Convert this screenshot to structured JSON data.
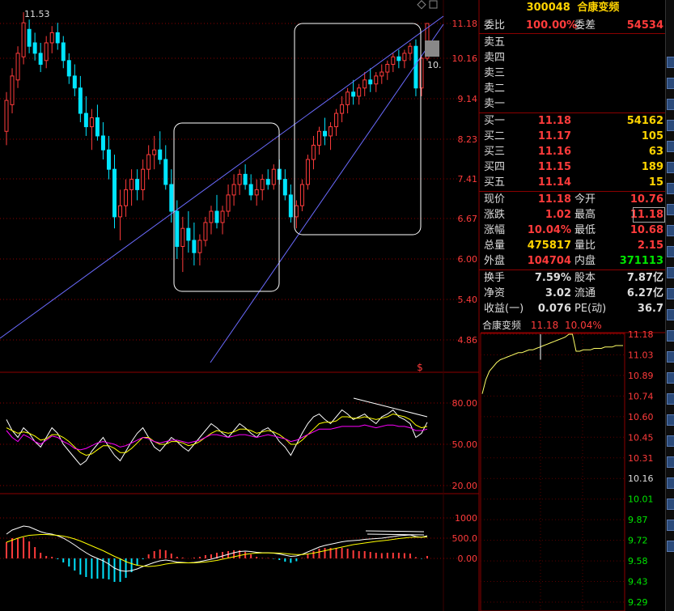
{
  "stock": {
    "code": "300048",
    "name": "合康变频",
    "peak_label": "11.53",
    "right_edge_label": "10."
  },
  "price_axis": [
    "11.18",
    "10.16",
    "9.14",
    "8.23",
    "7.41",
    "6.67",
    "6.00",
    "5.40",
    "4.86"
  ],
  "kdj_axis": [
    "80.00",
    "50.00",
    "20.00"
  ],
  "macd_axis": [
    "1000",
    "500.0",
    "0.00"
  ],
  "quote": {
    "weibi_label": "委比",
    "weibi_value": "100.00%",
    "weicha_label": "委差",
    "weicha_value": "54534",
    "sell": [
      {
        "label": "卖五",
        "price": "",
        "vol": ""
      },
      {
        "label": "卖四",
        "price": "",
        "vol": ""
      },
      {
        "label": "卖三",
        "price": "",
        "vol": ""
      },
      {
        "label": "卖二",
        "price": "",
        "vol": ""
      },
      {
        "label": "卖一",
        "price": "",
        "vol": ""
      }
    ],
    "buy": [
      {
        "label": "买一",
        "price": "11.18",
        "vol": "54162"
      },
      {
        "label": "买二",
        "price": "11.17",
        "vol": "105"
      },
      {
        "label": "买三",
        "price": "11.16",
        "vol": "63"
      },
      {
        "label": "买四",
        "price": "11.15",
        "vol": "189"
      },
      {
        "label": "买五",
        "price": "11.14",
        "vol": "15"
      }
    ],
    "stats": [
      {
        "l1": "现价",
        "v1": "11.18",
        "c1": "red",
        "l2": "今开",
        "v2": "10.76",
        "c2": "red"
      },
      {
        "l1": "涨跌",
        "v1": "1.02",
        "c1": "red",
        "l2": "最高",
        "v2": "11.18",
        "c2": "red"
      },
      {
        "l1": "涨幅",
        "v1": "10.04%",
        "c1": "red",
        "l2": "最低",
        "v2": "10.68",
        "c2": "red"
      },
      {
        "l1": "总量",
        "v1": "475817",
        "c1": "yellow",
        "l2": "量比",
        "v2": "2.15",
        "c2": "red"
      },
      {
        "l1": "外盘",
        "v1": "104704",
        "c1": "red",
        "l2": "内盘",
        "v2": "371113",
        "c2": "green"
      }
    ],
    "fundamentals": [
      {
        "l1": "换手",
        "v1": "7.59%",
        "l2": "股本",
        "v2": "7.87亿"
      },
      {
        "l1": "净资",
        "v1": "3.02",
        "l2": "流通",
        "v2": "6.27亿"
      },
      {
        "l1": "收益(一)",
        "v1": "0.076",
        "l2": "PE(动)",
        "v2": "36.7"
      }
    ]
  },
  "mini_chart": {
    "title_name": "合康变频",
    "title_price": "11.18",
    "title_pct": "10.04%",
    "axis": [
      "11.18",
      "11.03",
      "10.89",
      "10.74",
      "10.60",
      "10.45",
      "10.31",
      "10.16",
      "10.01",
      "9.87",
      "9.72",
      "9.58",
      "9.43",
      "9.29"
    ]
  },
  "colors": {
    "up": "#ff3b3b",
    "down": "#00e5ff",
    "kdj_k": "#ffffff",
    "kdj_d": "#ffff00",
    "kdj_j": "#ff00ff",
    "trend_line": "#6b6bff",
    "grid": "#8b0000"
  },
  "candles": [
    [
      8.4,
      9.3,
      8.1,
      9.1
    ],
    [
      9.0,
      9.9,
      8.8,
      9.7
    ],
    [
      9.6,
      10.5,
      9.4,
      10.3
    ],
    [
      10.2,
      11.53,
      10.0,
      11.2
    ],
    [
      11.0,
      11.3,
      10.3,
      10.5
    ],
    [
      10.6,
      10.9,
      10.1,
      10.3
    ],
    [
      10.3,
      10.6,
      9.8,
      10.0
    ],
    [
      10.1,
      10.8,
      9.9,
      10.6
    ],
    [
      10.6,
      11.1,
      10.3,
      10.9
    ],
    [
      10.9,
      11.2,
      10.4,
      10.6
    ],
    [
      10.6,
      10.8,
      9.9,
      10.1
    ],
    [
      10.1,
      10.3,
      9.5,
      9.7
    ],
    [
      9.7,
      10.0,
      9.2,
      9.4
    ],
    [
      9.4,
      9.7,
      8.6,
      8.8
    ],
    [
      8.8,
      9.2,
      8.3,
      8.5
    ],
    [
      8.5,
      8.9,
      8.0,
      8.7
    ],
    [
      8.7,
      9.0,
      8.2,
      8.3
    ],
    [
      8.3,
      8.6,
      7.8,
      8.0
    ],
    [
      8.0,
      8.3,
      7.4,
      7.6
    ],
    [
      7.6,
      7.9,
      6.5,
      6.7
    ],
    [
      6.7,
      7.2,
      6.3,
      6.9
    ],
    [
      6.9,
      7.4,
      6.7,
      7.2
    ],
    [
      7.2,
      7.6,
      6.9,
      7.4
    ],
    [
      7.4,
      7.6,
      7.0,
      7.2
    ],
    [
      7.2,
      7.8,
      7.0,
      7.6
    ],
    [
      7.6,
      8.1,
      7.4,
      7.9
    ],
    [
      7.9,
      8.3,
      7.6,
      8.0
    ],
    [
      8.0,
      8.4,
      7.7,
      7.8
    ],
    [
      7.8,
      8.1,
      7.2,
      7.3
    ],
    [
      7.3,
      7.6,
      6.6,
      6.8
    ],
    [
      6.8,
      7.0,
      6.0,
      6.2
    ],
    [
      6.2,
      6.7,
      5.8,
      6.5
    ],
    [
      6.5,
      6.8,
      6.1,
      6.3
    ],
    [
      6.3,
      6.6,
      5.9,
      6.1
    ],
    [
      6.1,
      6.4,
      5.9,
      6.3
    ],
    [
      6.3,
      6.7,
      6.2,
      6.6
    ],
    [
      6.6,
      6.9,
      6.4,
      6.8
    ],
    [
      6.8,
      7.1,
      6.5,
      6.6
    ],
    [
      6.6,
      6.9,
      6.4,
      6.8
    ],
    [
      6.8,
      7.3,
      6.7,
      7.1
    ],
    [
      7.1,
      7.5,
      6.9,
      7.3
    ],
    [
      7.3,
      7.6,
      7.1,
      7.5
    ],
    [
      7.5,
      7.7,
      7.2,
      7.3
    ],
    [
      7.3,
      7.5,
      7.0,
      7.1
    ],
    [
      7.1,
      7.4,
      6.9,
      7.2
    ],
    [
      7.2,
      7.5,
      7.0,
      7.4
    ],
    [
      7.4,
      7.6,
      7.2,
      7.3
    ],
    [
      7.3,
      7.7,
      7.2,
      7.6
    ],
    [
      7.6,
      7.8,
      7.3,
      7.4
    ],
    [
      7.4,
      7.6,
      7.0,
      7.1
    ],
    [
      7.1,
      7.3,
      6.6,
      6.7
    ],
    [
      6.7,
      7.0,
      6.5,
      6.9
    ],
    [
      6.9,
      7.4,
      6.8,
      7.3
    ],
    [
      7.3,
      7.9,
      7.2,
      7.8
    ],
    [
      7.8,
      8.3,
      7.6,
      8.1
    ],
    [
      8.1,
      8.5,
      7.9,
      8.4
    ],
    [
      8.4,
      8.7,
      8.1,
      8.3
    ],
    [
      8.3,
      8.6,
      8.0,
      8.5
    ],
    [
      8.5,
      8.9,
      8.3,
      8.8
    ],
    [
      8.8,
      9.2,
      8.6,
      9.0
    ],
    [
      9.0,
      9.4,
      8.8,
      9.3
    ],
    [
      9.3,
      9.6,
      9.0,
      9.2
    ],
    [
      9.2,
      9.5,
      9.0,
      9.4
    ],
    [
      9.4,
      9.8,
      9.2,
      9.6
    ],
    [
      9.6,
      9.9,
      9.3,
      9.5
    ],
    [
      9.5,
      9.8,
      9.3,
      9.7
    ],
    [
      9.7,
      10.0,
      9.5,
      9.8
    ],
    [
      9.8,
      10.1,
      9.6,
      10.0
    ],
    [
      10.0,
      10.3,
      9.8,
      10.2
    ],
    [
      10.2,
      10.4,
      9.9,
      10.1
    ],
    [
      10.1,
      10.4,
      9.9,
      10.3
    ],
    [
      10.3,
      10.6,
      10.1,
      10.5
    ],
    [
      10.5,
      10.7,
      9.2,
      9.4
    ],
    [
      9.4,
      10.2,
      9.2,
      10.16
    ],
    [
      10.16,
      11.18,
      10.1,
      11.18
    ]
  ],
  "kdj": {
    "k": [
      68,
      60,
      55,
      62,
      58,
      52,
      48,
      55,
      62,
      58,
      50,
      45,
      40,
      35,
      38,
      45,
      50,
      55,
      48,
      42,
      38,
      45,
      52,
      58,
      62,
      55,
      48,
      45,
      50,
      55,
      52,
      48,
      45,
      50,
      55,
      60,
      65,
      62,
      58,
      55,
      60,
      65,
      62,
      58,
      55,
      60,
      62,
      58,
      52,
      48,
      42,
      50,
      58,
      65,
      70,
      72,
      68,
      65,
      70,
      75,
      72,
      68,
      70,
      72,
      68,
      65,
      70,
      72,
      75,
      70,
      68,
      65,
      55,
      58,
      66
    ],
    "d": [
      62,
      60,
      58,
      59,
      58,
      56,
      53,
      54,
      57,
      57,
      55,
      52,
      48,
      44,
      42,
      43,
      46,
      49,
      49,
      47,
      44,
      44,
      47,
      51,
      55,
      55,
      52,
      50,
      50,
      52,
      52,
      51,
      49,
      50,
      52,
      55,
      58,
      60,
      59,
      58,
      59,
      61,
      61,
      60,
      58,
      59,
      60,
      59,
      57,
      54,
      50,
      50,
      53,
      57,
      61,
      65,
      66,
      66,
      67,
      70,
      70,
      69,
      69,
      70,
      69,
      68,
      69,
      70,
      72,
      71,
      70,
      68,
      64,
      62,
      63
    ],
    "j": [
      60,
      55,
      52,
      57,
      55,
      52,
      50,
      53,
      56,
      55,
      52,
      50,
      47,
      46,
      47,
      49,
      51,
      52,
      51,
      50,
      48,
      49,
      51,
      53,
      55,
      54,
      52,
      51,
      52,
      53,
      53,
      52,
      51,
      52,
      53,
      55,
      57,
      57,
      56,
      55,
      56,
      57,
      57,
      56,
      55,
      56,
      57,
      56,
      55,
      54,
      52,
      53,
      55,
      57,
      59,
      61,
      61,
      61,
      62,
      63,
      63,
      63,
      63,
      64,
      63,
      62,
      63,
      64,
      64,
      63,
      63,
      62,
      60,
      60,
      61
    ]
  },
  "macd": {
    "dif": [
      600,
      700,
      750,
      800,
      780,
      720,
      660,
      620,
      600,
      560,
      500,
      420,
      330,
      230,
      140,
      60,
      0,
      -60,
      -140,
      -240,
      -300,
      -320,
      -300,
      -260,
      -200,
      -150,
      -100,
      -60,
      -40,
      -60,
      -90,
      -100,
      -110,
      -100,
      -80,
      -50,
      -20,
      20,
      60,
      100,
      140,
      170,
      180,
      170,
      150,
      140,
      140,
      130,
      110,
      80,
      50,
      60,
      100,
      160,
      220,
      280,
      320,
      350,
      380,
      410,
      430,
      440,
      450,
      470,
      480,
      490,
      500,
      520,
      540,
      560,
      570,
      580,
      540,
      520,
      560
    ],
    "dea": [
      400,
      450,
      500,
      540,
      570,
      580,
      590,
      590,
      580,
      570,
      550,
      520,
      480,
      430,
      370,
      310,
      250,
      190,
      120,
      50,
      -10,
      -80,
      -130,
      -170,
      -190,
      -200,
      -190,
      -170,
      -140,
      -120,
      -110,
      -110,
      -110,
      -110,
      -100,
      -90,
      -70,
      -50,
      -20,
      10,
      40,
      70,
      100,
      120,
      130,
      135,
      135,
      135,
      130,
      120,
      105,
      95,
      95,
      110,
      130,
      160,
      190,
      220,
      250,
      280,
      310,
      340,
      360,
      380,
      400,
      420,
      435,
      450,
      470,
      490,
      505,
      520,
      525,
      525,
      530
    ]
  }
}
